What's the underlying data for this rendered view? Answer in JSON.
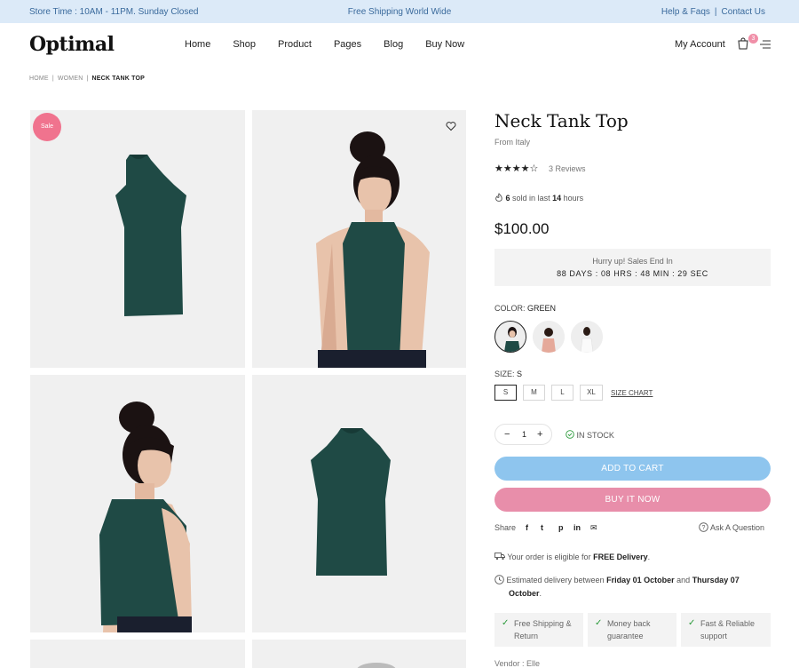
{
  "topbar": {
    "store_time": "Store Time : 10AM - 11PM. Sunday Closed",
    "shipping": "Free Shipping World Wide",
    "help": "Help & Faqs",
    "contact": "Contact Us"
  },
  "header": {
    "logo": "Optimal",
    "nav": [
      "Home",
      "Shop",
      "Product",
      "Pages",
      "Blog",
      "Buy Now"
    ],
    "account": "My Account",
    "cart_count": "3"
  },
  "breadcrumb": [
    "HOME",
    "WOMEN",
    "NECK TANK TOP"
  ],
  "gallery": {
    "sale_badge": "Sale"
  },
  "product": {
    "title": "Neck Tank Top",
    "origin": "From Italy",
    "rating": 4.5,
    "stars": "★★★★☆",
    "reviews": "3 Reviews",
    "sold_count": "6",
    "sold_mid": "sold in last",
    "sold_hours": "14",
    "sold_suffix": "hours",
    "price": "$100.00",
    "countdown_title": "Hurry up! Sales End In",
    "countdown": "88 DAYS : 08 HRS : 48 MIN : 29 SEC",
    "color_label": "COLOR:",
    "color_value": "GREEN",
    "size_label": "SIZE:",
    "size_value": "S",
    "sizes": [
      "S",
      "M",
      "L",
      "XL"
    ],
    "size_chart": "SIZE CHART",
    "qty": "1",
    "qty_minus": "−",
    "qty_plus": "+",
    "stock": "IN STOCK",
    "add_to_cart": "ADD TO CART",
    "buy_now": "BUY IT NOW",
    "share": "Share",
    "social_icons": [
      "f",
      "t",
      "p",
      "in",
      "✉"
    ],
    "ask": "Ask A Question",
    "delivery_pre": "Your order is eligible for",
    "delivery_bold": "FREE Delivery",
    "estimate_pre": "Estimated delivery between",
    "estimate_date1": "Friday 01 October",
    "estimate_and": "and",
    "estimate_date2": "Thursday 07",
    "estimate_date2b": "October",
    "features": [
      {
        "line1": "Free Shipping &",
        "line2": "Return"
      },
      {
        "line1": "Money back",
        "line2": "guarantee"
      },
      {
        "line1": "Fast & Reliable",
        "line2": "support"
      }
    ],
    "vendor": "Vendor : Elle"
  },
  "colors": {
    "topbar_bg": "#dceaf8",
    "accent_blue": "#8ec5ee",
    "accent_pink": "#e88eaa",
    "top_green": "#1f4a45"
  }
}
